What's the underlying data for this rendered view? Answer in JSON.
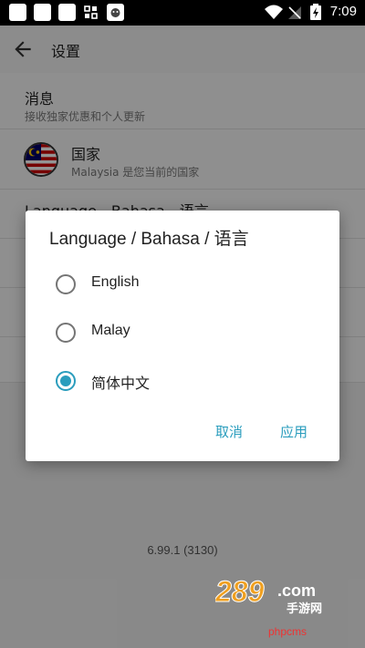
{
  "status_bar": {
    "time": "7:09"
  },
  "toolbar": {
    "title": "设置"
  },
  "settings": {
    "messages": {
      "title": "消息",
      "subtitle": "接收独家优惠和个人更新"
    },
    "country": {
      "title": "国家",
      "subtitle": "Malaysia 是您当前的国家"
    },
    "language": {
      "title": "Language - Bahasa - 语言"
    }
  },
  "version": "6.99.1 (3130)",
  "dialog": {
    "title": "Language / Bahasa / 语言",
    "options": [
      {
        "label": "English",
        "selected": false
      },
      {
        "label": "Malay",
        "selected": false
      },
      {
        "label": "简体中文",
        "selected": true
      }
    ],
    "cancel": "取消",
    "apply": "应用"
  },
  "watermark": {
    "logo": "289.com 手游网",
    "text": "phpcms"
  },
  "colors": {
    "accent": "#2a9dbd"
  }
}
